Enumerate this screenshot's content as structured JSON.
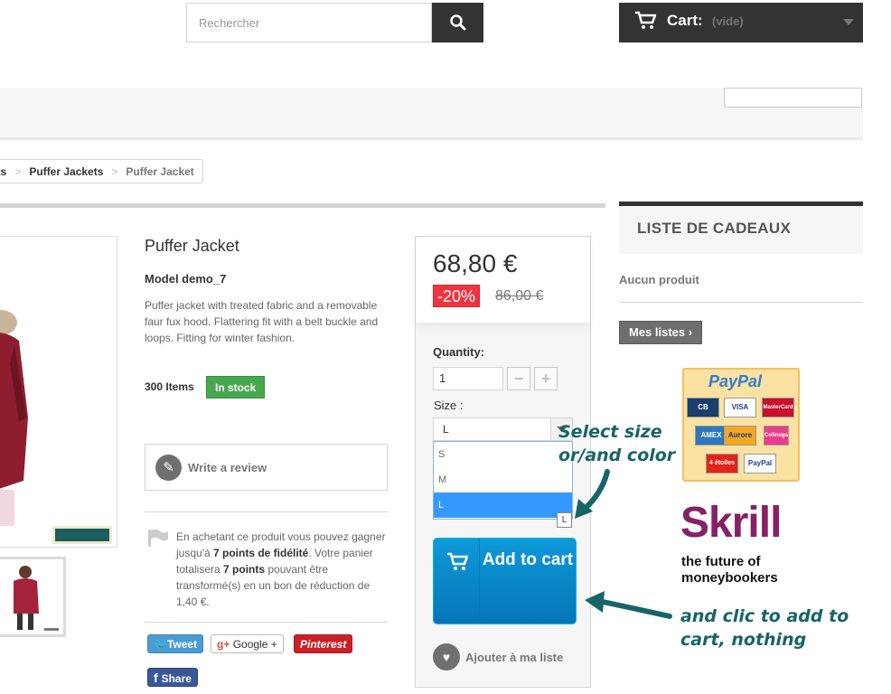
{
  "header": {
    "search_placeholder": "Rechercher",
    "cart_label": "Cart:",
    "cart_status": "(vide)"
  },
  "breadcrumb": {
    "items": [
      "ets",
      "Puffer Jackets",
      "Puffer Jacket"
    ]
  },
  "product": {
    "title": "Puffer Jacket",
    "model": "Model demo_7",
    "description": "Puffer jacket with treated fabric and a removable faur fux hood. Flattering fit with a belt buckle and loops. Fitting for winter fashion.",
    "items_count": "300 Items",
    "stock_status": "In stock",
    "review_label": "Write a review",
    "loyalty": {
      "part1": "En achetant ce produit vous pouvez gagner jusqu'à ",
      "points": "7 points de fidélité",
      "part2": ". Votre panier totalisera ",
      "points2": "7 points",
      "part3": " pouvant être transformé(s) en un bon de réduction de 1,40 €."
    }
  },
  "social": {
    "tweet": "Tweet",
    "google": "Google +",
    "pinterest": "Pinterest",
    "share": "Share"
  },
  "buy_box": {
    "price": "68,80 €",
    "discount": "-20%",
    "old_price": "86,00 €",
    "quantity_label": "Quantity:",
    "quantity_value": "1",
    "size_label": "Size :",
    "size_selected": "L",
    "size_options": [
      "S",
      "M",
      "L"
    ],
    "tooltip": "L",
    "add_to_cart": "Add to cart",
    "wishlist": "Ajouter à ma liste"
  },
  "annotations": {
    "select": "Select size or/and color",
    "click": "and clic to add to cart, nothing"
  },
  "sidebar": {
    "gift_title": "LISTE DE CADEAUX",
    "no_product": "Aucun produit",
    "my_lists": "Mes listes",
    "paypal_logo": "PayPal",
    "cards": [
      "CB",
      "VISA",
      "MasterCard",
      "AMEX",
      "Aurore",
      "Cofinoga",
      "4 étoiles",
      "PayPal"
    ],
    "skrill": "Skrill",
    "skrill_tagline": "the future of moneybookers"
  },
  "colors": {
    "accent_blue": "#0575b8",
    "stock_green": "#46a74e",
    "discount_red": "#f13340",
    "annotation_teal": "#176468",
    "skrill_purple": "#862165"
  }
}
